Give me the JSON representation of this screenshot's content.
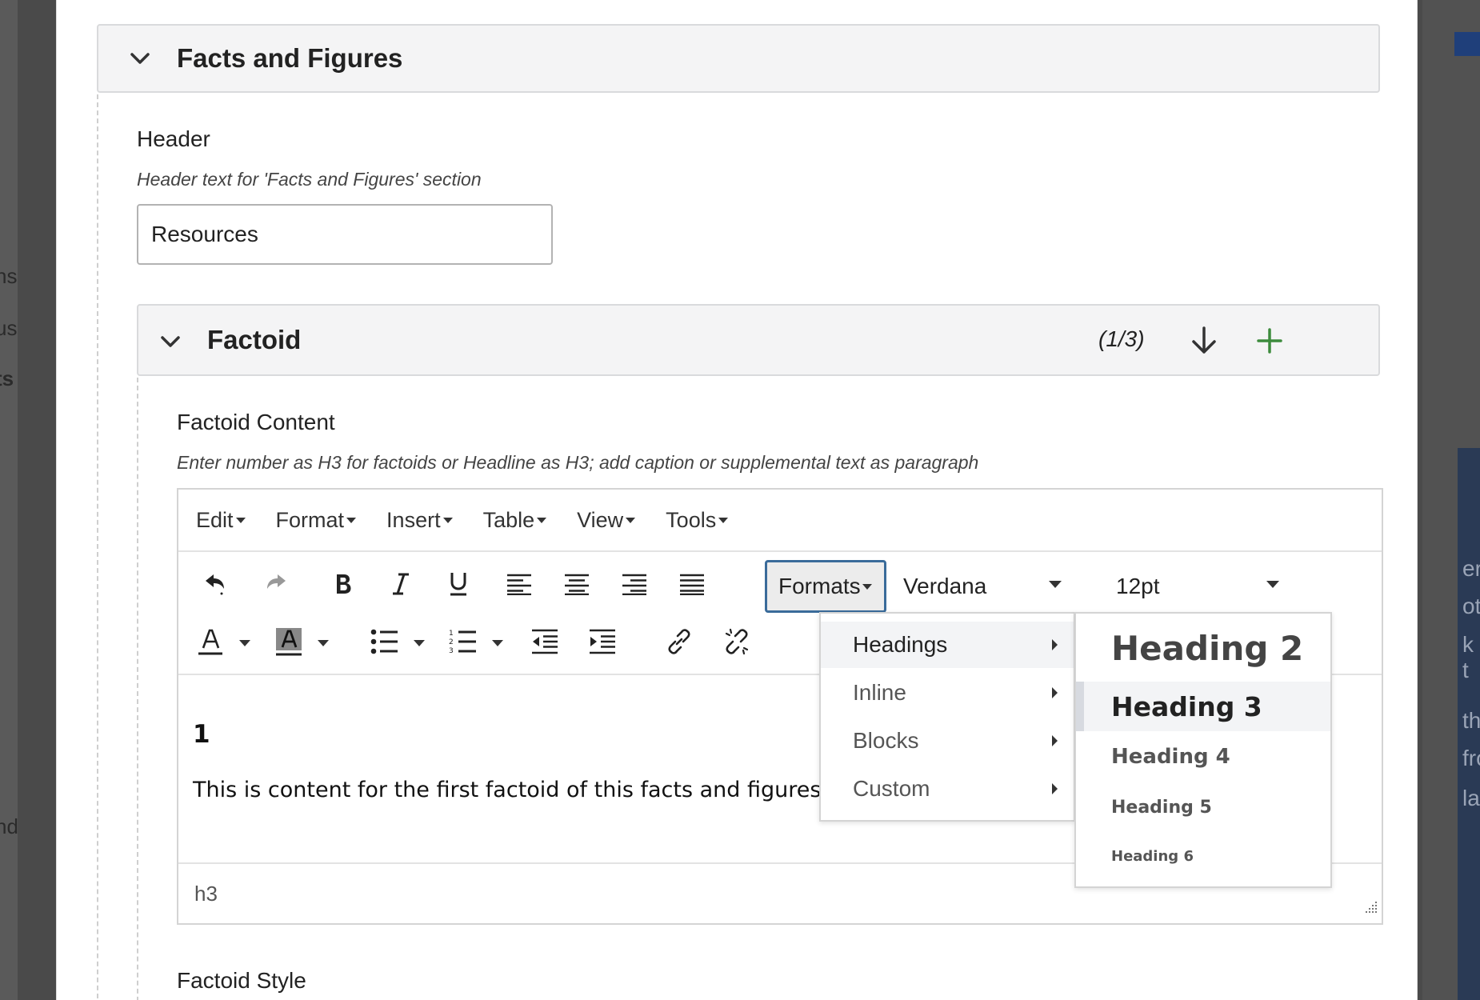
{
  "background": {
    "left_fragments": [
      "ns",
      "us",
      "ts",
      "nd"
    ],
    "right_fragments": [
      "er",
      "ot",
      "k t",
      "th",
      "fro",
      "lan"
    ]
  },
  "section": {
    "title": "Facts and Figures",
    "header_field": {
      "label": "Header",
      "help": "Header text for 'Facts and Figures' section",
      "value": "Resources"
    }
  },
  "factoid": {
    "title": "Factoid",
    "count": "(1/3)",
    "content_label": "Factoid Content",
    "content_help": "Enter number as H3 for factoids or Headline as H3; add caption or supplemental text as paragraph",
    "style_label": "Factoid Style"
  },
  "editor": {
    "menus": [
      "Edit",
      "Format",
      "Insert",
      "Table",
      "View",
      "Tools"
    ],
    "formats_label": "Formats",
    "font_family": "Verdana",
    "font_size": "12pt",
    "content_heading": "1",
    "content_paragraph": "This is content for the first factoid of this facts and figures section.",
    "status_path": "h3"
  },
  "formats_menu": {
    "items": [
      "Headings",
      "Inline",
      "Blocks",
      "Custom"
    ],
    "active": "Headings"
  },
  "headings_menu": {
    "items": [
      "Heading 2",
      "Heading 3",
      "Heading 4",
      "Heading 5",
      "Heading 6"
    ],
    "active": "Heading 3"
  },
  "colors": {
    "add_green": "#3d8b3d",
    "focus_border": "#3a6b9a"
  }
}
